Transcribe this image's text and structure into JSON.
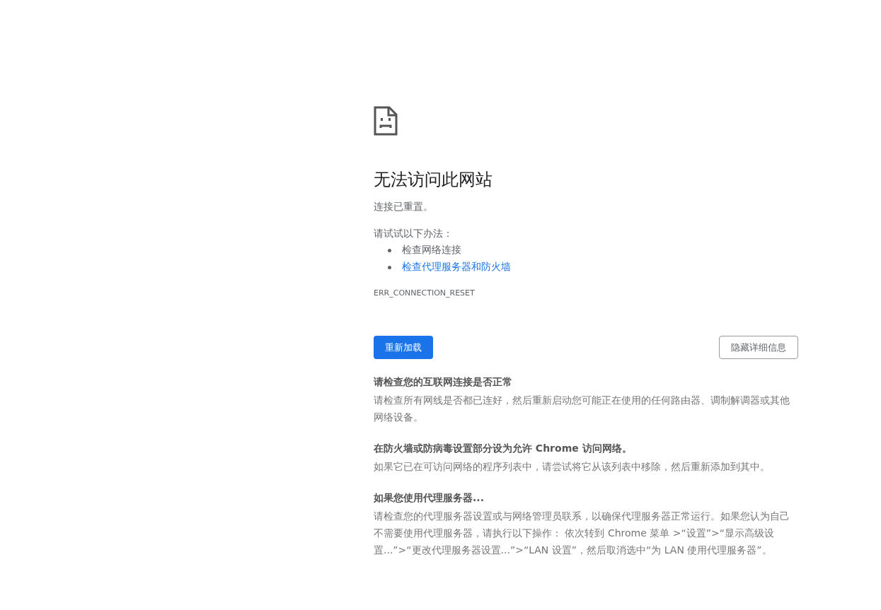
{
  "title": "无法访问此网站",
  "subtitle": "连接已重置。",
  "suggestions_heading": "请试试以下办法：",
  "suggestions": [
    {
      "kind": "text",
      "label": "检查网络连接"
    },
    {
      "kind": "link",
      "label": "检查代理服务器和防火墙"
    }
  ],
  "error_code": "ERR_CONNECTION_RESET",
  "buttons": [
    {
      "kind": "primary",
      "label": "重新加载"
    },
    {
      "kind": "secondary",
      "label": "隐藏详细信息"
    }
  ],
  "details": [
    {
      "heading": "请检查您的互联网连接是否正常",
      "body": "请检查所有网线是否都已连好，然后重新启动您可能正在使用的任何路由器、调制解调器或其他网络设备。"
    },
    {
      "heading": "在防火墙或防病毒设置部分设为允许 Chrome 访问网络。",
      "body": "如果它已在可访问网络的程序列表中，请尝试将它从该列表中移除，然后重新添加到其中。"
    },
    {
      "heading": "如果您使用代理服务器...",
      "body": "请检查您的代理服务器设置或与网络管理员联系，以确保代理服务器正常运行。如果您认为自己不需要使用代理服务器，请执行以下操作： 依次转到 Chrome 菜单 >“设置”>“显示高级设置...”>“更改代理服务器设置...”>“LAN 设置”，然后取消选中“为 LAN 使用代理服务器”。"
    }
  ]
}
